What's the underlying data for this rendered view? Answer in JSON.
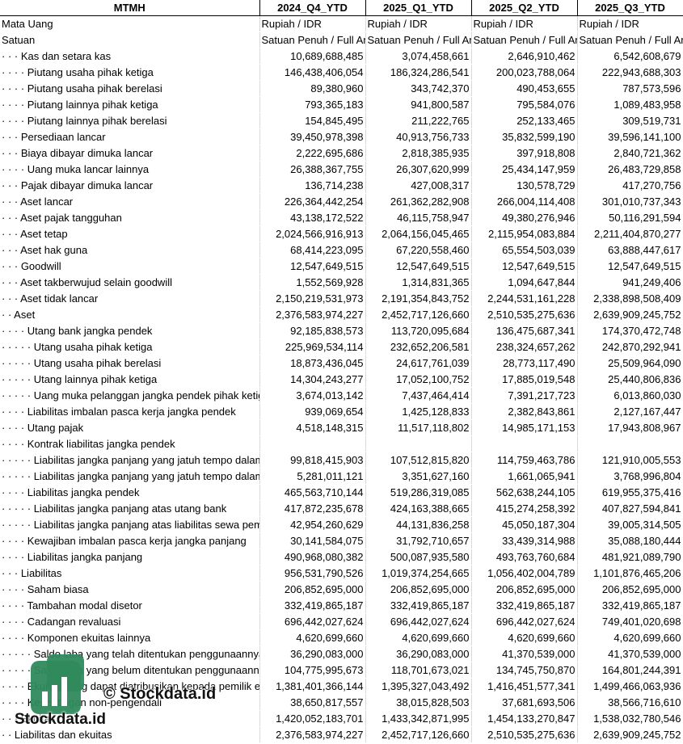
{
  "header": [
    "MTMH",
    "2024_Q4_YTD",
    "2025_Q1_YTD",
    "2025_Q2_YTD",
    "2025_Q3_YTD"
  ],
  "rows": [
    [
      "Mata Uang",
      "Rupiah / IDR",
      "Rupiah / IDR",
      "Rupiah / IDR",
      "Rupiah / IDR"
    ],
    [
      "Satuan",
      "Satuan Penuh / Full Amount",
      "Satuan Penuh / Full Amount",
      "Satuan Penuh / Full Amount",
      "Satuan Penuh / Full Amount"
    ],
    [
      "· · · Kas dan setara kas",
      "10,689,688,485",
      "3,074,458,661",
      "2,646,910,462",
      "6,542,608,679"
    ],
    [
      "· · · · Piutang usaha pihak ketiga",
      "146,438,406,054",
      "186,324,286,541",
      "200,023,788,064",
      "222,943,688,303"
    ],
    [
      "· · · · Piutang usaha pihak berelasi",
      "89,380,960",
      "343,742,370",
      "490,453,655",
      "787,573,596"
    ],
    [
      "· · · · Piutang lainnya pihak ketiga",
      "793,365,183",
      "941,800,587",
      "795,584,076",
      "1,089,483,958"
    ],
    [
      "· · · · Piutang lainnya pihak berelasi",
      "154,845,495",
      "211,222,765",
      "252,133,465",
      "309,519,731"
    ],
    [
      "· · · Persediaan lancar",
      "39,450,978,398",
      "40,913,756,733",
      "35,832,599,190",
      "39,596,141,100"
    ],
    [
      "· · · Biaya dibayar dimuka lancar",
      "2,222,695,686",
      "2,818,385,935",
      "397,918,808",
      "2,840,721,362"
    ],
    [
      "· · · · Uang muka lancar lainnya",
      "26,388,367,755",
      "26,307,620,999",
      "25,434,147,959",
      "26,483,729,858"
    ],
    [
      "· · · Pajak dibayar dimuka lancar",
      "136,714,238",
      "427,008,317",
      "130,578,729",
      "417,270,756"
    ],
    [
      "· · · Aset lancar",
      "226,364,442,254",
      "261,362,282,908",
      "266,004,114,408",
      "301,010,737,343"
    ],
    [
      "· · · Aset pajak tangguhan",
      "43,138,172,522",
      "46,115,758,947",
      "49,380,276,946",
      "50,116,291,594"
    ],
    [
      "· · · Aset tetap",
      "2,024,566,916,913",
      "2,064,156,045,465",
      "2,115,954,083,884",
      "2,211,404,870,277"
    ],
    [
      "· · · Aset hak guna",
      "68,414,223,095",
      "67,220,558,460",
      "65,554,503,039",
      "63,888,447,617"
    ],
    [
      "· · · Goodwill",
      "12,547,649,515",
      "12,547,649,515",
      "12,547,649,515",
      "12,547,649,515"
    ],
    [
      "· · · Aset takberwujud selain goodwill",
      "1,552,569,928",
      "1,314,831,365",
      "1,094,647,844",
      "941,249,406"
    ],
    [
      "· · · Aset tidak lancar",
      "2,150,219,531,973",
      "2,191,354,843,752",
      "2,244,531,161,228",
      "2,338,898,508,409"
    ],
    [
      "· · Aset",
      "2,376,583,974,227",
      "2,452,717,126,660",
      "2,510,535,275,636",
      "2,639,909,245,752"
    ],
    [
      "· · · · Utang bank jangka pendek",
      "92,185,838,573",
      "113,720,095,684",
      "136,475,687,341",
      "174,370,472,748"
    ],
    [
      "· · · · · Utang usaha pihak ketiga",
      "225,969,534,114",
      "232,652,206,581",
      "238,324,657,262",
      "242,870,292,941"
    ],
    [
      "· · · · · Utang usaha pihak berelasi",
      "18,873,436,045",
      "24,617,761,039",
      "28,773,117,490",
      "25,509,964,090"
    ],
    [
      "· · · · · Utang lainnya pihak ketiga",
      "14,304,243,277",
      "17,052,100,752",
      "17,885,019,548",
      "25,440,806,836"
    ],
    [
      "· · · · · Uang muka pelanggan jangka pendek pihak ketiga",
      "3,674,013,142",
      "7,437,464,414",
      "7,391,217,723",
      "6,013,860,030"
    ],
    [
      "· · · · Liabilitas imbalan pasca kerja jangka pendek",
      "939,069,654",
      "1,425,128,833",
      "2,382,843,861",
      "2,127,167,447"
    ],
    [
      "· · · · Utang pajak",
      "4,518,148,315",
      "11,517,118,802",
      "14,985,171,153",
      "17,943,808,967"
    ],
    [
      "· · · · Kontrak liabilitas jangka pendek",
      "",
      "",
      "",
      ""
    ],
    [
      "· · · · · Liabilitas jangka panjang yang jatuh tempo dalam satu tahun",
      "99,818,415,903",
      "107,512,815,820",
      "114,759,463,786",
      "121,910,005,553"
    ],
    [
      "· · · · · Liabilitas jangka panjang yang jatuh tempo dalam satu tahun",
      "5,281,011,121",
      "3,351,627,160",
      "1,661,065,941",
      "3,768,996,804"
    ],
    [
      "· · · · Liabilitas jangka pendek",
      "465,563,710,144",
      "519,286,319,085",
      "562,638,244,105",
      "619,955,375,416"
    ],
    [
      "· · · · · Liabilitas jangka panjang atas utang bank",
      "417,872,235,678",
      "424,163,388,665",
      "415,274,258,392",
      "407,827,594,841"
    ],
    [
      "· · · · · Liabilitas jangka panjang atas liabilitas sewa pembiayaan",
      "42,954,260,629",
      "44,131,836,258",
      "45,050,187,304",
      "39,005,314,505"
    ],
    [
      "· · · · Kewajiban imbalan pasca kerja jangka panjang",
      "30,141,584,075",
      "31,792,710,657",
      "33,439,314,988",
      "35,088,180,444"
    ],
    [
      "· · · · Liabilitas jangka panjang",
      "490,968,080,382",
      "500,087,935,580",
      "493,763,760,684",
      "481,921,089,790"
    ],
    [
      "· · · Liabilitas",
      "956,531,790,526",
      "1,019,374,254,665",
      "1,056,402,004,789",
      "1,101,876,465,206"
    ],
    [
      "· · · · Saham biasa",
      "206,852,695,000",
      "206,852,695,000",
      "206,852,695,000",
      "206,852,695,000"
    ],
    [
      "· · · · Tambahan modal disetor",
      "332,419,865,187",
      "332,419,865,187",
      "332,419,865,187",
      "332,419,865,187"
    ],
    [
      "· · · · Cadangan revaluasi",
      "696,442,027,624",
      "696,442,027,624",
      "696,442,027,624",
      "749,401,020,698"
    ],
    [
      "· · · · Komponen ekuitas lainnya",
      "4,620,699,660",
      "4,620,699,660",
      "4,620,699,660",
      "4,620,699,660"
    ],
    [
      "· · · · · Saldo laba yang telah ditentukan penggunaannya",
      "36,290,083,000",
      "36,290,083,000",
      "41,370,539,000",
      "41,370,539,000"
    ],
    [
      "· · · · · Saldo laba yang belum ditentukan penggunaannya",
      "104,775,995,673",
      "118,701,673,021",
      "134,745,750,870",
      "164,801,244,391"
    ],
    [
      "· · · · Ekuitas yang dapat diatribusikan kepada pemilik entitas induk",
      "1,381,401,366,144",
      "1,395,327,043,492",
      "1,416,451,577,341",
      "1,499,466,063,936"
    ],
    [
      "· · · · Kepentingan non-pengendali",
      "38,650,817,557",
      "38,015,828,503",
      "37,681,693,506",
      "38,566,716,610"
    ],
    [
      "· · · Ekuitas",
      "1,420,052,183,701",
      "1,433,342,871,995",
      "1,454,133,270,847",
      "1,538,032,780,546"
    ],
    [
      "· · Liabilitas dan ekuitas",
      "2,376,583,974,227",
      "2,452,717,126,660",
      "2,510,535,275,636",
      "2,639,909,245,752"
    ]
  ],
  "watermark": {
    "copyright": "© Stockdata.id",
    "brand": "Stockdata.id",
    "logo_color": "#2f8a5c"
  }
}
